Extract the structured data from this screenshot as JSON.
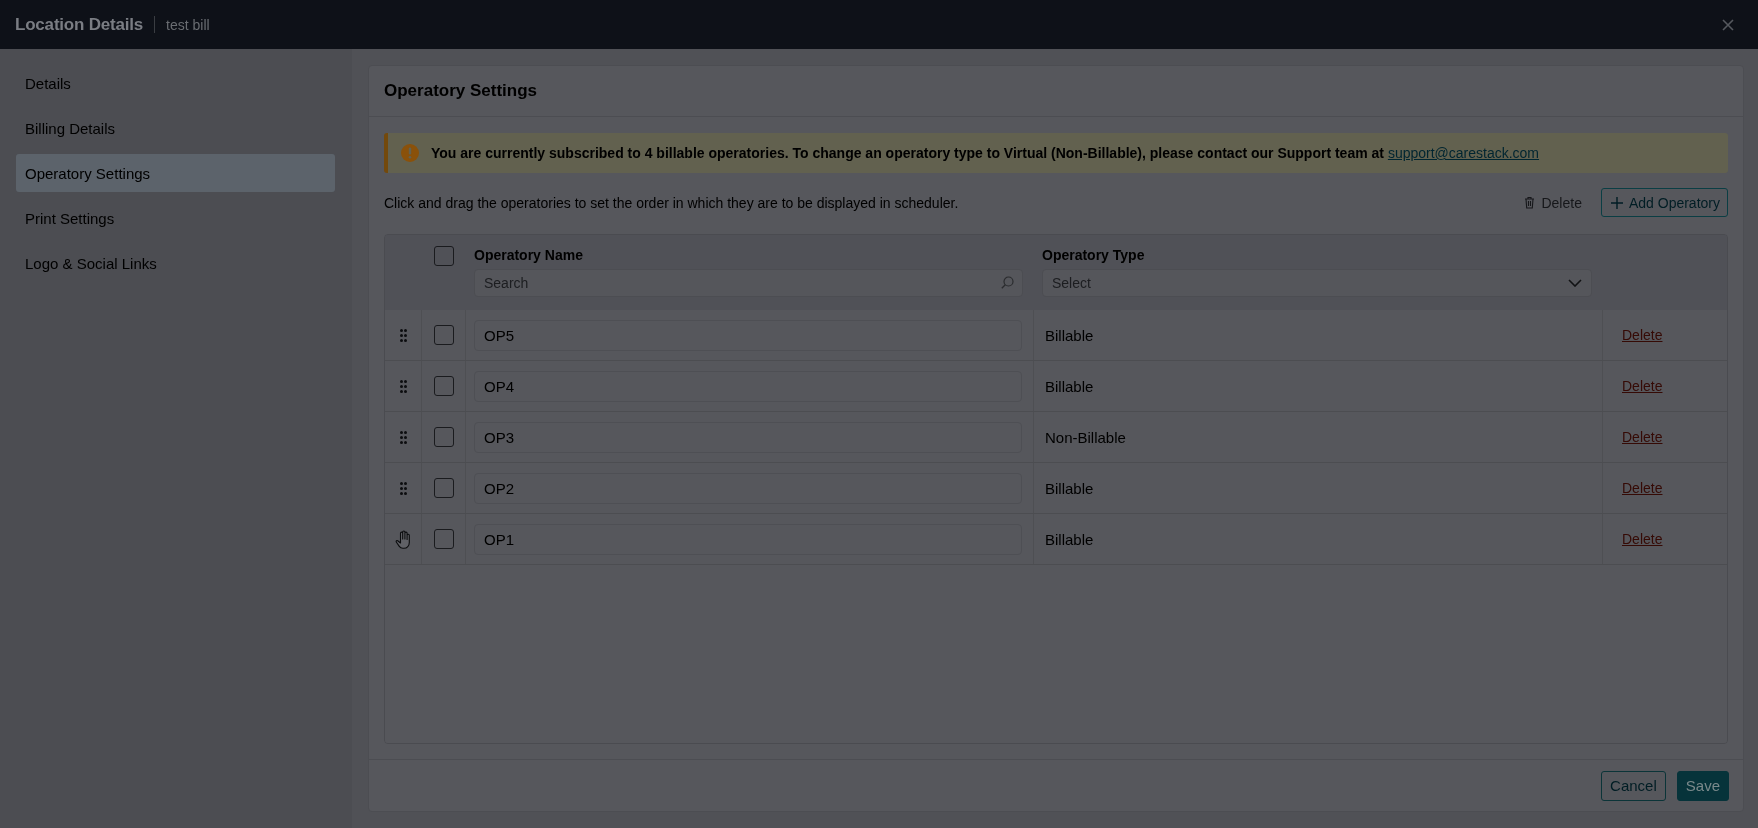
{
  "window": {
    "title": "Location Details",
    "subtitle": "test bill"
  },
  "sidebar": {
    "items": [
      {
        "label": "Details",
        "selected": false
      },
      {
        "label": "Billing Details",
        "selected": false
      },
      {
        "label": "Operatory Settings",
        "selected": true
      },
      {
        "label": "Print Settings",
        "selected": false
      },
      {
        "label": "Logo & Social Links",
        "selected": false
      }
    ]
  },
  "panel": {
    "title": "Operatory Settings",
    "alert": {
      "text": "You are currently subscribed to 4 billable operatories. To change an operatory type to Virtual (Non-Billable), please contact our Support team at",
      "link": "support@carestack.com"
    },
    "instructions": "Click and drag the operatories to set the order in which they are to be displayed in scheduler.",
    "toolbar": {
      "delete": {
        "label": "Delete",
        "disabled": true
      },
      "add": {
        "label": "Add Operatory"
      }
    },
    "table": {
      "select_all": {
        "checked": false
      },
      "columns": [
        {
          "label": "Operatory Name",
          "filter": {
            "kind": "search",
            "placeholder": "Search"
          }
        },
        {
          "label": "Operatory Type",
          "filter": {
            "kind": "select",
            "placeholder": "Select"
          }
        }
      ],
      "rows": [
        {
          "name": "OP5",
          "type": "Billable",
          "action": "Delete",
          "checked": false,
          "hovered": false
        },
        {
          "name": "OP4",
          "type": "Billable",
          "action": "Delete",
          "checked": false,
          "hovered": false
        },
        {
          "name": "OP3",
          "type": "Non-Billable",
          "action": "Delete",
          "checked": false,
          "hovered": false
        },
        {
          "name": "OP2",
          "type": "Billable",
          "action": "Delete",
          "checked": false,
          "hovered": false
        },
        {
          "name": "OP1",
          "type": "Billable",
          "action": "Delete",
          "checked": false,
          "hovered": true
        }
      ]
    },
    "footer": {
      "buttons": [
        {
          "label": "Cancel",
          "kind": "secondary"
        },
        {
          "label": "Save",
          "kind": "primary"
        }
      ]
    }
  }
}
